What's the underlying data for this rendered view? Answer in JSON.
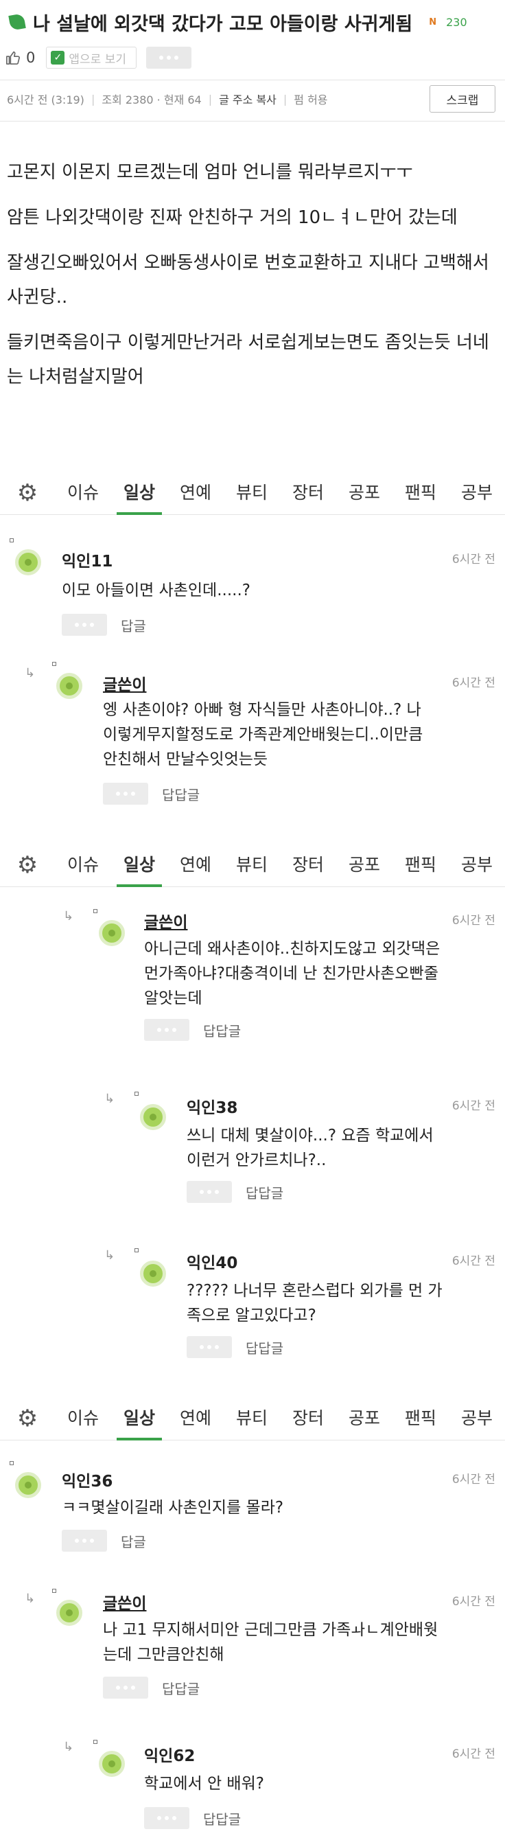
{
  "post": {
    "title": "나 설날에 외갓댁 갔다가 고모 아들이랑 사귀게됨",
    "n_badge": "N",
    "hit_count": "230",
    "like_count": "0",
    "app_view_label": "앱으로 보기",
    "time": "6시간 전 (3:19)",
    "views": "조회 2380 · 현재 64",
    "copy_url": "글 주소 복사",
    "permission": "펌 허용",
    "scrap_label": "스크랩",
    "paragraphs": [
      "고몬지 이몬지 모르겠는데 엄마 언니를 뭐라부르지ㅜㅜ",
      "암튼 나외갓댁이랑 진짜 안친하구 거의 10ㄴㅕㄴ만어 갔는데",
      "잘생긴오빠있어서 오빠동생사이로 번호교환하고 지내다 고백해서 사귄당..",
      "들키면죽음이구 이렇게만난거라 서로쉽게보는면도 좀잇는듯 너네는 나처럼살지말어"
    ]
  },
  "categories": [
    "이슈",
    "일상",
    "연예",
    "뷰티",
    "장터",
    "공포",
    "팬픽",
    "공부"
  ],
  "active_category": "일상",
  "comments": [
    {
      "name": "익인11",
      "time": "6시간 전",
      "lines": [
        "이모 아들이면 사촌인데.....?"
      ],
      "reply_label": "답글"
    },
    {
      "name": "글쓴이",
      "time": "6시간 전",
      "lines": [
        "엥 사촌이야? 아빠 형 자식들만 사촌아니야..? 나",
        "이렇게무지할정도로 가족관계안배웟는디..이만큼",
        "안친해서 만날수잇엇는듯"
      ],
      "reply_label": "답답글"
    },
    {
      "name": "글쓴이",
      "time": "6시간 전",
      "lines": [
        "아니근데 왜사촌이야..친하지도않고 외갓댁은",
        "먼가족아냐?대충격이네 난 친가만사촌오빤줄",
        "알앗는데"
      ],
      "reply_label": "답답글"
    },
    {
      "name": "익인38",
      "time": "6시간 전",
      "lines": [
        "쓰니 대체 몇살이야...? 요즘 학교에서",
        "이런거 안가르치나?.."
      ],
      "reply_label": "답답글"
    },
    {
      "name": "익인40",
      "time": "6시간 전",
      "lines": [
        "????? 나너무 혼란스럽다 외가를 먼 가",
        "족으로 알고있다고?"
      ],
      "reply_label": "답답글"
    },
    {
      "name": "익인36",
      "time": "6시간 전",
      "lines": [
        "ㅋㅋ몇살이길래 사촌인지를 몰라?"
      ],
      "reply_label": "답글"
    },
    {
      "name": "글쓴이",
      "time": "6시간 전",
      "lines": [
        "나 고1 무지해서미안 근데그만큼 가족ㅘㄴ계안배웟",
        "는데 그만큼안친해"
      ],
      "reply_label": "답답글"
    },
    {
      "name": "익인62",
      "time": "6시간 전",
      "lines": [
        "학교에서 안 배워?"
      ],
      "reply_label": "답답글"
    }
  ],
  "colors": {
    "accent": "#3aa24a",
    "badge": "#e07a20"
  }
}
